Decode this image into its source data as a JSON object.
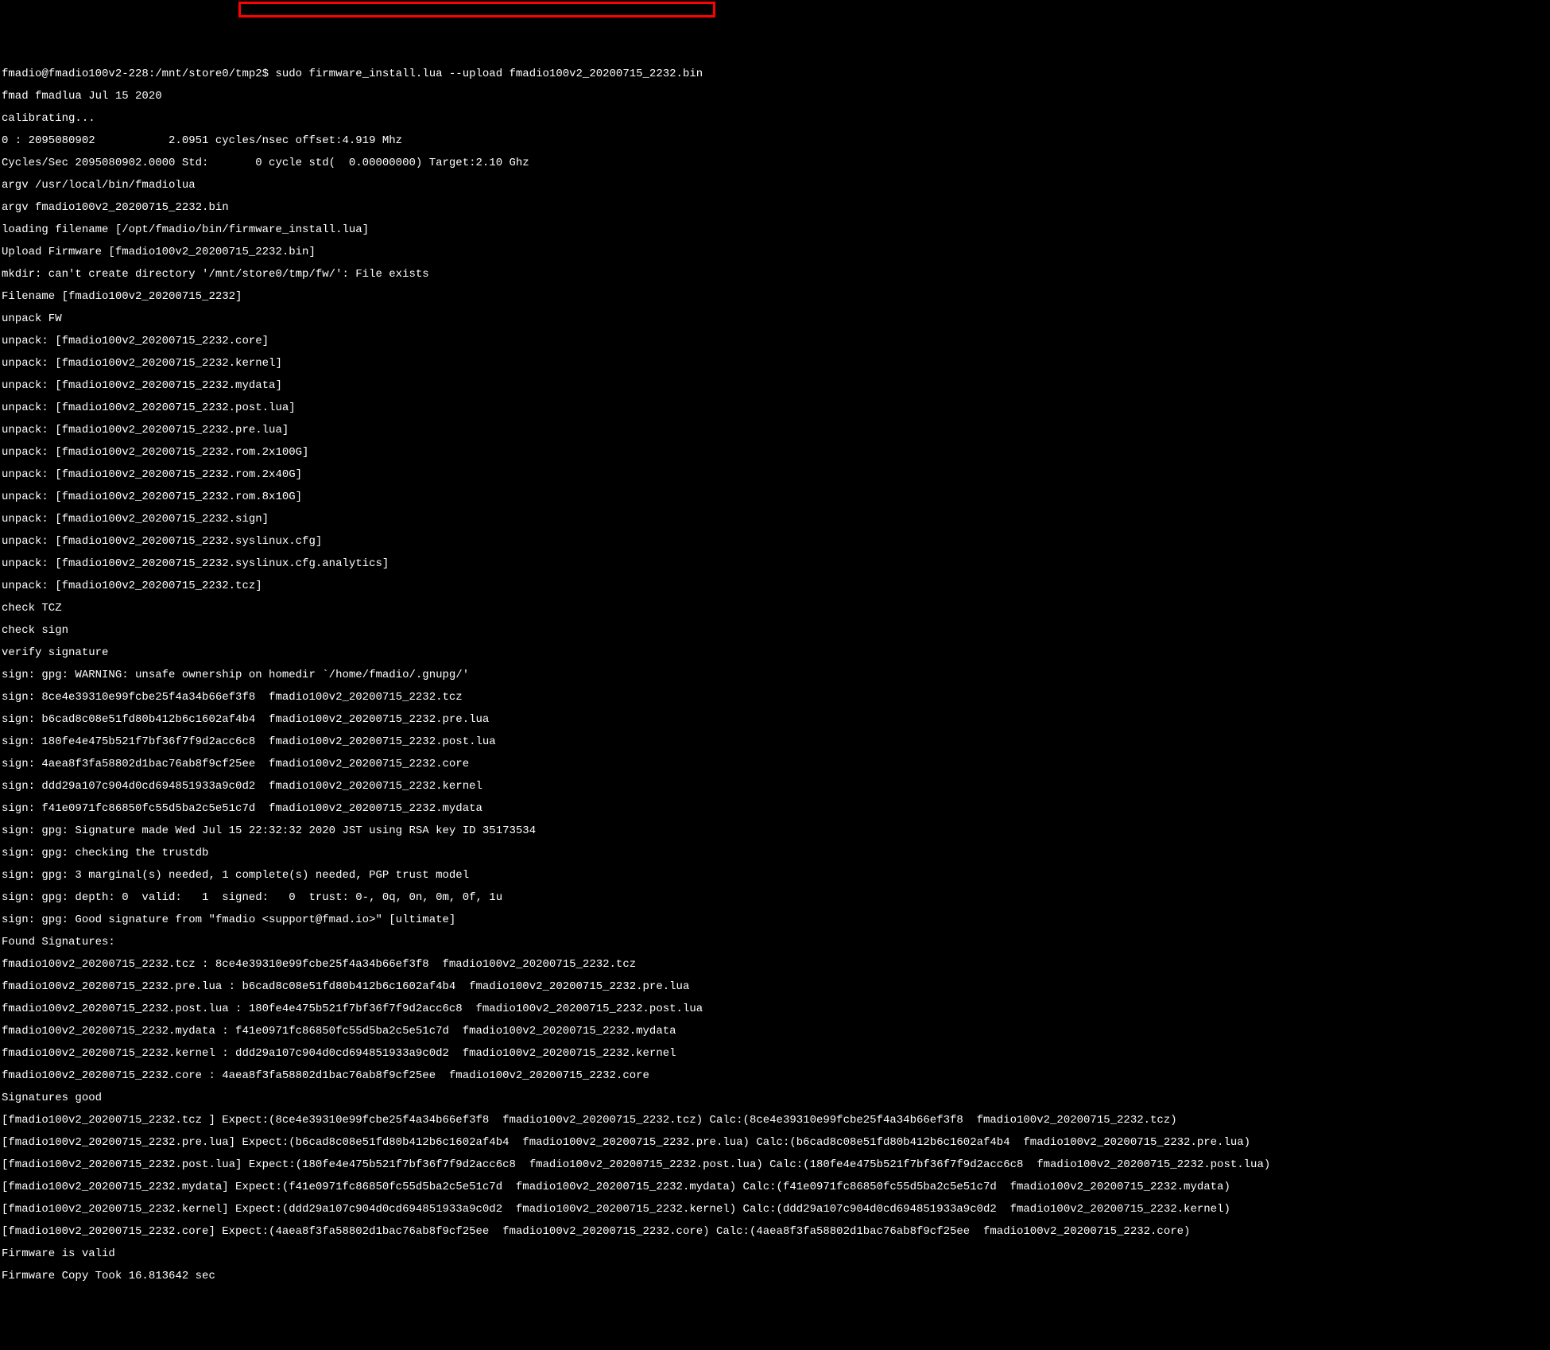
{
  "lines": [
    "fmadio@fmadio100v2-228:/mnt/store0/tmp2$ sudo firmware_install.lua --upload fmadio100v2_20200715_2232.bin",
    "fmad fmadlua Jul 15 2020",
    "calibrating...",
    "0 : 2095080902           2.0951 cycles/nsec offset:4.919 Mhz",
    "Cycles/Sec 2095080902.0000 Std:       0 cycle std(  0.00000000) Target:2.10 Ghz",
    "argv /usr/local/bin/fmadiolua",
    "argv fmadio100v2_20200715_2232.bin",
    "loading filename [/opt/fmadio/bin/firmware_install.lua]",
    "Upload Firmware [fmadio100v2_20200715_2232.bin]",
    "mkdir: can't create directory '/mnt/store0/tmp/fw/': File exists",
    "Filename [fmadio100v2_20200715_2232]",
    "unpack FW",
    "unpack: [fmadio100v2_20200715_2232.core]",
    "unpack: [fmadio100v2_20200715_2232.kernel]",
    "unpack: [fmadio100v2_20200715_2232.mydata]",
    "unpack: [fmadio100v2_20200715_2232.post.lua]",
    "unpack: [fmadio100v2_20200715_2232.pre.lua]",
    "unpack: [fmadio100v2_20200715_2232.rom.2x100G]",
    "unpack: [fmadio100v2_20200715_2232.rom.2x40G]",
    "unpack: [fmadio100v2_20200715_2232.rom.8x10G]",
    "unpack: [fmadio100v2_20200715_2232.sign]",
    "unpack: [fmadio100v2_20200715_2232.syslinux.cfg]",
    "unpack: [fmadio100v2_20200715_2232.syslinux.cfg.analytics]",
    "unpack: [fmadio100v2_20200715_2232.tcz]",
    "check TCZ",
    "check sign",
    "verify signature",
    "sign: gpg: WARNING: unsafe ownership on homedir `/home/fmadio/.gnupg/'",
    "sign: 8ce4e39310e99fcbe25f4a34b66ef3f8  fmadio100v2_20200715_2232.tcz",
    "sign: b6cad8c08e51fd80b412b6c1602af4b4  fmadio100v2_20200715_2232.pre.lua",
    "sign: 180fe4e475b521f7bf36f7f9d2acc6c8  fmadio100v2_20200715_2232.post.lua",
    "sign: 4aea8f3fa58802d1bac76ab8f9cf25ee  fmadio100v2_20200715_2232.core",
    "sign: ddd29a107c904d0cd694851933a9c0d2  fmadio100v2_20200715_2232.kernel",
    "sign: f41e0971fc86850fc55d5ba2c5e51c7d  fmadio100v2_20200715_2232.mydata",
    "sign: gpg: Signature made Wed Jul 15 22:32:32 2020 JST using RSA key ID 35173534",
    "sign: gpg: checking the trustdb",
    "sign: gpg: 3 marginal(s) needed, 1 complete(s) needed, PGP trust model",
    "sign: gpg: depth: 0  valid:   1  signed:   0  trust: 0-, 0q, 0n, 0m, 0f, 1u",
    "sign: gpg: Good signature from \"fmadio <support@fmad.io>\" [ultimate]",
    "Found Signatures:",
    "fmadio100v2_20200715_2232.tcz : 8ce4e39310e99fcbe25f4a34b66ef3f8  fmadio100v2_20200715_2232.tcz",
    "fmadio100v2_20200715_2232.pre.lua : b6cad8c08e51fd80b412b6c1602af4b4  fmadio100v2_20200715_2232.pre.lua",
    "fmadio100v2_20200715_2232.post.lua : 180fe4e475b521f7bf36f7f9d2acc6c8  fmadio100v2_20200715_2232.post.lua",
    "fmadio100v2_20200715_2232.mydata : f41e0971fc86850fc55d5ba2c5e51c7d  fmadio100v2_20200715_2232.mydata",
    "fmadio100v2_20200715_2232.kernel : ddd29a107c904d0cd694851933a9c0d2  fmadio100v2_20200715_2232.kernel",
    "fmadio100v2_20200715_2232.core : 4aea8f3fa58802d1bac76ab8f9cf25ee  fmadio100v2_20200715_2232.core",
    "Signatures good",
    "[fmadio100v2_20200715_2232.tcz ] Expect:(8ce4e39310e99fcbe25f4a34b66ef3f8  fmadio100v2_20200715_2232.tcz) Calc:(8ce4e39310e99fcbe25f4a34b66ef3f8  fmadio100v2_20200715_2232.tcz)",
    "[fmadio100v2_20200715_2232.pre.lua] Expect:(b6cad8c08e51fd80b412b6c1602af4b4  fmadio100v2_20200715_2232.pre.lua) Calc:(b6cad8c08e51fd80b412b6c1602af4b4  fmadio100v2_20200715_2232.pre.lua)",
    "[fmadio100v2_20200715_2232.post.lua] Expect:(180fe4e475b521f7bf36f7f9d2acc6c8  fmadio100v2_20200715_2232.post.lua) Calc:(180fe4e475b521f7bf36f7f9d2acc6c8  fmadio100v2_20200715_2232.post.lua)",
    "[fmadio100v2_20200715_2232.mydata] Expect:(f41e0971fc86850fc55d5ba2c5e51c7d  fmadio100v2_20200715_2232.mydata) Calc:(f41e0971fc86850fc55d5ba2c5e51c7d  fmadio100v2_20200715_2232.mydata)",
    "[fmadio100v2_20200715_2232.kernel] Expect:(ddd29a107c904d0cd694851933a9c0d2  fmadio100v2_20200715_2232.kernel) Calc:(ddd29a107c904d0cd694851933a9c0d2  fmadio100v2_20200715_2232.kernel)",
    "[fmadio100v2_20200715_2232.core] Expect:(4aea8f3fa58802d1bac76ab8f9cf25ee  fmadio100v2_20200715_2232.core) Calc:(4aea8f3fa58802d1bac76ab8f9cf25ee  fmadio100v2_20200715_2232.core)",
    "Firmware is valid",
    "Firmware Copy Took 16.813642 sec"
  ],
  "highlight": {
    "command": "sudo firmware_install.lua --upload fmadio100v2_20200715_2232.bin"
  }
}
